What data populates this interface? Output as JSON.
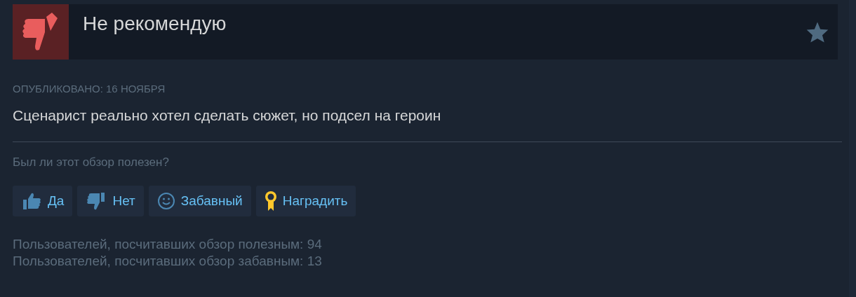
{
  "review": {
    "verdict": "Не рекомендую",
    "recommended": false,
    "posted": "ОПУБЛИКОВАНО: 16 НОЯБРЯ",
    "text": "Сценарист реально хотел сделать сюжет, но подсел на героин"
  },
  "helpful_prompt": "Был ли этот обзор полезен?",
  "buttons": [
    {
      "kind": "yes",
      "label": "Да"
    },
    {
      "kind": "no",
      "label": "Нет"
    },
    {
      "kind": "funny",
      "label": "Забавный"
    },
    {
      "kind": "award",
      "label": "Наградить"
    }
  ],
  "stats": [
    "Пользователей, посчитавших обзор полезным: 94",
    "Пользователей, посчитавших обзор забавным: 13"
  ]
}
